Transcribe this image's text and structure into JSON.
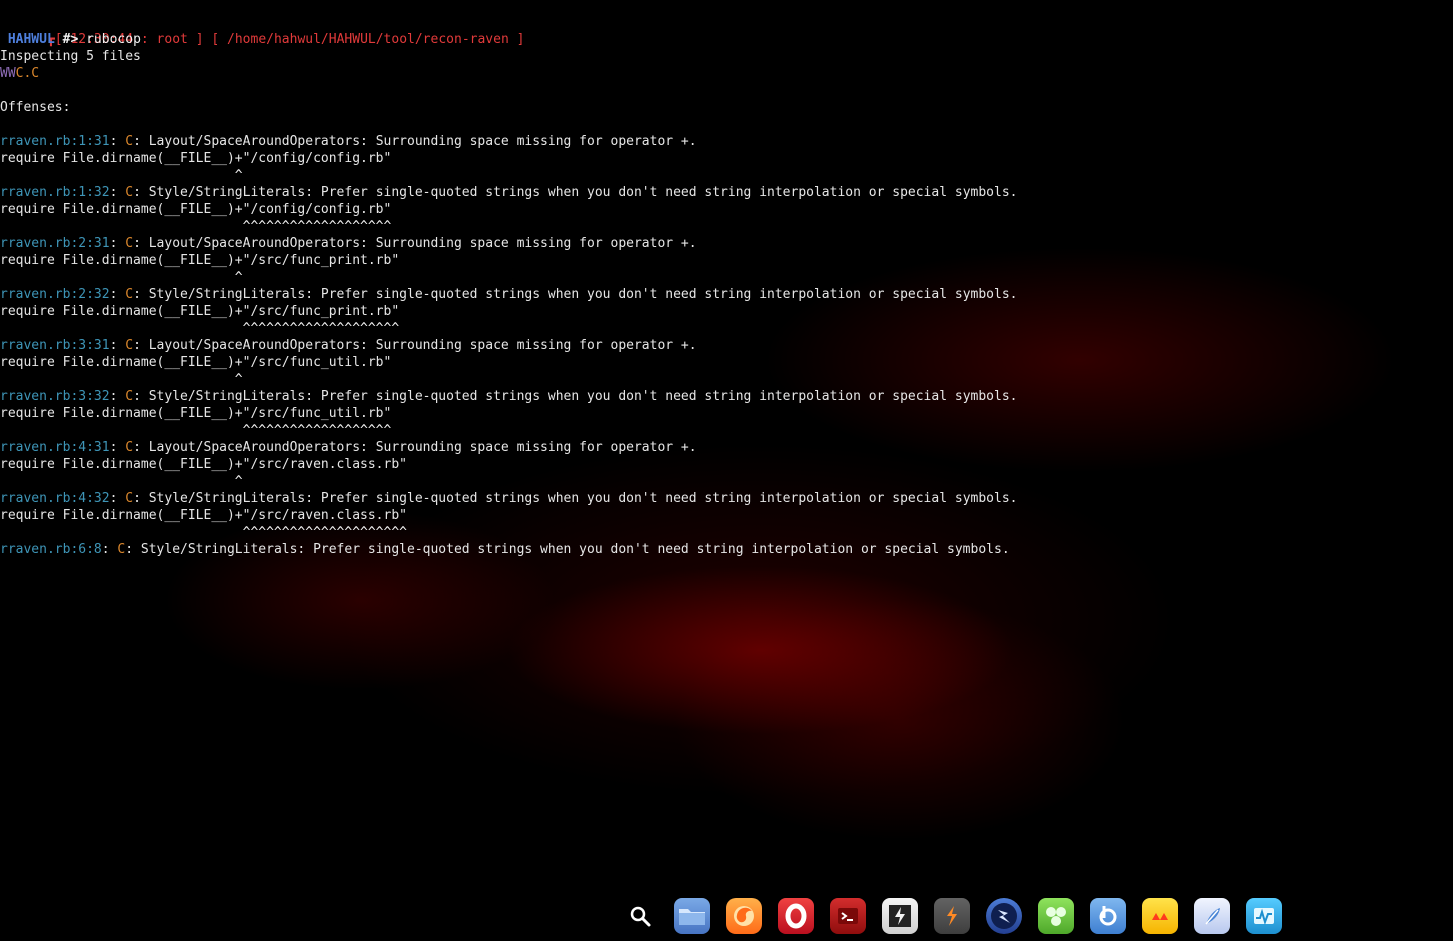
{
  "terminal": {
    "prompt_bracket_prefix": "┏[",
    "prompt_time": " 12:30:44 ",
    "prompt_sep1": ":",
    "prompt_user": " root ",
    "prompt_sep2": "] [",
    "prompt_path": " /home/hahwul/HAHWUL/tool/recon-raven ",
    "prompt_end": "]",
    "host_label": "HAHWUL",
    "prompt_symbol": "#>",
    "command": " rubocop",
    "lines": [
      "Inspecting 5 files",
      "WWC.C",
      "",
      "Offenses:",
      "",
      "rraven.rb:1:31: C: Layout/SpaceAroundOperators: Surrounding space missing for operator +.",
      "require File.dirname(__FILE__)+\"/config/config.rb\"",
      "                              ^",
      "rraven.rb:1:32: C: Style/StringLiterals: Prefer single-quoted strings when you don't need string interpolation or special symbols.",
      "require File.dirname(__FILE__)+\"/config/config.rb\"",
      "                               ^^^^^^^^^^^^^^^^^^^",
      "rraven.rb:2:31: C: Layout/SpaceAroundOperators: Surrounding space missing for operator +.",
      "require File.dirname(__FILE__)+\"/src/func_print.rb\"",
      "                              ^",
      "rraven.rb:2:32: C: Style/StringLiterals: Prefer single-quoted strings when you don't need string interpolation or special symbols.",
      "require File.dirname(__FILE__)+\"/src/func_print.rb\"",
      "                               ^^^^^^^^^^^^^^^^^^^^",
      "rraven.rb:3:31: C: Layout/SpaceAroundOperators: Surrounding space missing for operator +.",
      "require File.dirname(__FILE__)+\"/src/func_util.rb\"",
      "                              ^",
      "rraven.rb:3:32: C: Style/StringLiterals: Prefer single-quoted strings when you don't need string interpolation or special symbols.",
      "require File.dirname(__FILE__)+\"/src/func_util.rb\"",
      "                               ^^^^^^^^^^^^^^^^^^^",
      "rraven.rb:4:31: C: Layout/SpaceAroundOperators: Surrounding space missing for operator +.",
      "require File.dirname(__FILE__)+\"/src/raven.class.rb\"",
      "                              ^",
      "rraven.rb:4:32: C: Style/StringLiterals: Prefer single-quoted strings when you don't need string interpolation or special symbols.",
      "require File.dirname(__FILE__)+\"/src/raven.class.rb\"",
      "                               ^^^^^^^^^^^^^^^^^^^^^",
      "rraven.rb:6:8: C: Style/StringLiterals: Prefer single-quoted strings when you don't need string interpolation or special symbols."
    ]
  },
  "dock": {
    "items": [
      {
        "name": "search-icon"
      },
      {
        "name": "file-manager-icon"
      },
      {
        "name": "firefox-icon"
      },
      {
        "name": "opera-icon"
      },
      {
        "name": "terminal-icon"
      },
      {
        "name": "zaproxy-icon"
      },
      {
        "name": "sublime-icon"
      },
      {
        "name": "owasp-zap-icon"
      },
      {
        "name": "maltego-icon"
      },
      {
        "name": "burp-icon"
      },
      {
        "name": "yakuake-icon"
      },
      {
        "name": "feather-icon"
      },
      {
        "name": "system-monitor-icon"
      }
    ]
  },
  "colors": {
    "background": "#000000",
    "prompt_red": "#e03a3a",
    "prompt_blue": "#4e7fdc",
    "file_cyan": "#3e95b7",
    "severity_orange": "#d9862c",
    "status_purple": "#8f6db8"
  }
}
